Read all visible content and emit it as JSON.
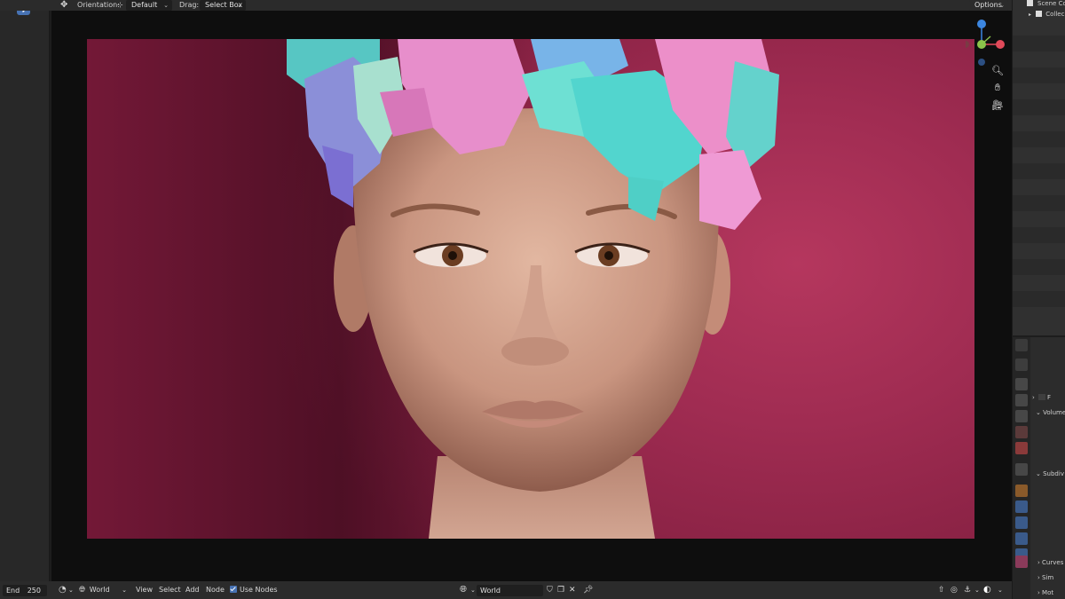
{
  "header": {
    "orientation_label": "Orientation:",
    "orientation_value": "Default",
    "drag_label": "Drag:",
    "drag_value": "Select Box",
    "options_label": "Options"
  },
  "outliner": {
    "scene_label": "Scene Co",
    "collection_label": "Collec"
  },
  "properties": {
    "row1": "F",
    "volume": "Volume",
    "subdiv": "Subdiv",
    "curves": "Curves",
    "sim": "Sim",
    "mot": "Mot"
  },
  "bottom": {
    "end_label": "End",
    "end_value": "250",
    "world_selector": "World",
    "menu_view": "View",
    "menu_select": "Select",
    "menu_add": "Add",
    "menu_node": "Node",
    "use_nodes": "Use Nodes",
    "world_name": "World"
  },
  "colors": {
    "accent": "#4772b3",
    "gizmo_x": "#e04a5a",
    "gizmo_y": "#8bc34a",
    "gizmo_z": "#3c86e0",
    "backdrop": "#a52d55"
  },
  "icons": [
    "transform-pivot-icon",
    "filter-icon",
    "zoom-icon",
    "hand-pan-icon",
    "camera-icon",
    "world-icon",
    "pin-icon",
    "shield-icon",
    "copy-icon",
    "close-icon"
  ]
}
